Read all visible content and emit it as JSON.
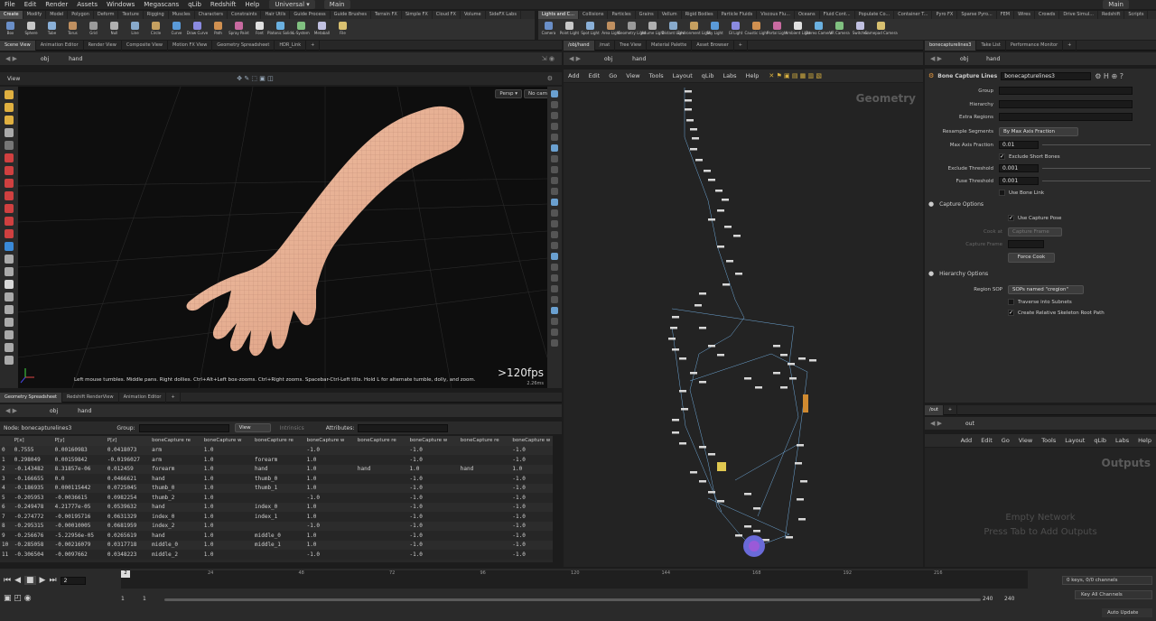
{
  "menubar": {
    "items": [
      "File",
      "Edit",
      "Render",
      "Assets",
      "Windows",
      "Megascans",
      "qLib",
      "Redshift",
      "Help"
    ],
    "desktop": "Universal",
    "scene": "Main",
    "right_title": "Main"
  },
  "shelf_tabs_left": [
    "Create",
    "Modify",
    "Model",
    "Polygon",
    "Deform",
    "Texture",
    "Rigging",
    "Muscles",
    "Characters",
    "Constraints",
    "Hair Utils",
    "Guide Process",
    "Guide Brushes",
    "Terrain FX",
    "Simple FX",
    "Cloud FX",
    "Volume",
    "SideFX Labs"
  ],
  "shelf_tabs_right": [
    "Lights and C...",
    "Collisions",
    "Particles",
    "Grains",
    "Vellum",
    "Rigid Bodies",
    "Particle Fluids",
    "Viscous Flu...",
    "Oceans",
    "Fluid Cont...",
    "Populate Co...",
    "Container T...",
    "Pyro FX",
    "Sparse Pyro...",
    "FEM",
    "Wires",
    "Crowds",
    "Drive Simul...",
    "Redshift",
    "Scripts"
  ],
  "shelf_tools_left": [
    "Box",
    "Sphere",
    "Tube",
    "Torus",
    "Grid",
    "Null",
    "Line",
    "Circle",
    "Curve",
    "Draw Curve",
    "Path",
    "Spray Paint",
    "Font",
    "Platonic Solids",
    "L-System",
    "Metaball",
    "File"
  ],
  "shelf_tools_right": [
    "Camera",
    "Point Light",
    "Spot Light",
    "Area Light",
    "Geometry Light",
    "Volume Light",
    "Distant Light",
    "Environment Light",
    "Sky Light",
    "GI Light",
    "Caustic Light",
    "Portal Light",
    "Ambient Light",
    "Stereo Camera",
    "VR Camera",
    "Switcher",
    "Gamepad Camera"
  ],
  "left_panetabs": [
    "Scene View",
    "Animation Editor",
    "Render View",
    "Composite View",
    "Motion FX View",
    "Geometry Spreadsheet",
    "HDR_Link"
  ],
  "mid_panetabs": [
    "/obj/hand",
    "/mat",
    "Tree View",
    "Material Palette",
    "Asset Browser"
  ],
  "right_panetabs": [
    "bonecapturelines3",
    "Take List",
    "Performance Monitor"
  ],
  "path": {
    "obj": "obj",
    "hand": "hand"
  },
  "viewport": {
    "title": "View",
    "camera_mode": "Persp",
    "camera": "No cam",
    "hint": "Left mouse tumbles. Middle pans. Right dollies. Ctrl+Alt+Left box-zooms. Ctrl+Right zooms. Spacebar-Ctrl-Left tilts. Hold L for alternate tumble, dolly, and zoom.",
    "fps": ">120fps",
    "ms": "2.26ms"
  },
  "bottom_left_tabs": [
    "Geometry Spreadsheet",
    "Redshift RenderView",
    "Animation Editor"
  ],
  "spreadsheet": {
    "node_label": "Node: bonecapturelines3",
    "group_label": "Group:",
    "view_label": "View",
    "intrinsics_label": "Intrinsics",
    "attributes_label": "Attributes:",
    "columns": [
      "",
      "P[x]",
      "P[y]",
      "P[z]",
      "boneCapture re",
      "boneCapture w",
      "boneCapture re",
      "boneCapture w",
      "boneCapture re",
      "boneCapture w",
      "boneCapture re",
      "boneCapture w",
      ""
    ],
    "rows": [
      [
        "0",
        "0.7555",
        "0.00160983",
        "0.0418073",
        "arm",
        "1.0",
        "",
        "-1.0",
        "",
        "-1.0",
        "",
        "-1.0",
        ""
      ],
      [
        "1",
        "0.298049",
        "0.00159842",
        "-0.0196027",
        "arm",
        "1.0",
        "forearm",
        "1.0",
        "",
        "-1.0",
        "",
        "-1.0",
        ""
      ],
      [
        "2",
        "-0.143482",
        "8.31857e-06",
        "0.012459",
        "forearm",
        "1.0",
        "hand",
        "1.0",
        "hand",
        "1.0",
        "hand",
        "1.0",
        "han"
      ],
      [
        "3",
        "-0.166655",
        "0.0",
        "0.0466621",
        "hand",
        "1.0",
        "thumb_0",
        "1.0",
        "",
        "-1.0",
        "",
        "-1.0",
        ""
      ],
      [
        "4",
        "-0.186935",
        "0.000115442",
        "0.0725045",
        "thumb_0",
        "1.0",
        "thumb_1",
        "1.0",
        "",
        "-1.0",
        "",
        "-1.0",
        ""
      ],
      [
        "5",
        "-0.205953",
        "-0.0036615",
        "0.0982254",
        "thumb_2",
        "1.0",
        "",
        "-1.0",
        "",
        "-1.0",
        "",
        "-1.0",
        ""
      ],
      [
        "6",
        "-0.249478",
        "4.21777e-05",
        "0.0539632",
        "hand",
        "1.0",
        "index_0",
        "1.0",
        "",
        "-1.0",
        "",
        "-1.0",
        ""
      ],
      [
        "7",
        "-0.274772",
        "-0.00195716",
        "0.0631329",
        "index_0",
        "1.0",
        "index_1",
        "1.0",
        "",
        "-1.0",
        "",
        "-1.0",
        ""
      ],
      [
        "8",
        "-0.295315",
        "-0.00010005",
        "0.0681959",
        "index_2",
        "1.0",
        "",
        "-1.0",
        "",
        "-1.0",
        "",
        "-1.0",
        ""
      ],
      [
        "9",
        "-0.256676",
        "-5.22956e-05",
        "0.0265619",
        "hand",
        "1.0",
        "middle_0",
        "1.0",
        "",
        "-1.0",
        "",
        "-1.0",
        ""
      ],
      [
        "10",
        "-0.285058",
        "-0.00216079",
        "0.0317718",
        "middle_0",
        "1.0",
        "middle_1",
        "1.0",
        "",
        "-1.0",
        "",
        "-1.0",
        ""
      ],
      [
        "11",
        "-0.306504",
        "-0.0097662",
        "0.0348223",
        "middle_2",
        "1.0",
        "",
        "-1.0",
        "",
        "-1.0",
        "",
        "-1.0",
        ""
      ]
    ]
  },
  "network": {
    "menu": [
      "Add",
      "Edit",
      "Go",
      "View",
      "Tools",
      "Layout",
      "qLib",
      "Labs",
      "Help"
    ],
    "watermark": "Geometry"
  },
  "params": {
    "node_type": "Bone Capture Lines",
    "node_name": "bonecapturelines3",
    "group_label": "Group",
    "hierarchy_label": "Hierarchy",
    "extra_regions_label": "Extra Regions",
    "resample_label": "Resample Segments",
    "resample_value": "By Max Axis Fraction",
    "max_axis_label": "Max Axis Fraction",
    "max_axis_value": "0.01",
    "exclude_short_label": "Exclude Short Bones",
    "exclude_threshold_label": "Exclude Threshold",
    "exclude_threshold_value": "0.001",
    "fuse_threshold_label": "Fuse Threshold",
    "fuse_threshold_value": "0.001",
    "use_bone_link_label": "Use Bone Link",
    "capture_options_label": "Capture Options",
    "use_capture_pose_label": "Use Capture Pose",
    "cook_at_label": "Cook at",
    "cook_at_value": "Capture Frame",
    "capture_frame_label": "Capture Frame",
    "force_cook_label": "Force Cook",
    "hierarchy_options_label": "Hierarchy Options",
    "region_sop_label": "Region SOP",
    "region_sop_value": "SOPs named \"cregion\"",
    "traverse_label": "Traverse into Subnets",
    "create_relative_label": "Create Relative Skeleton Root Path"
  },
  "out_panel": {
    "path_tab": "/out",
    "path": "out",
    "menu": [
      "Add",
      "Edit",
      "Go",
      "View",
      "Tools",
      "Layout",
      "qLib",
      "Labs",
      "Help"
    ],
    "watermark": "Outputs",
    "empty_line1": "Empty Network",
    "empty_line2": "Press Tab to Add Outputs"
  },
  "timeline": {
    "current_frame": "2",
    "ticks": [
      "24",
      "48",
      "72",
      "96",
      "120",
      "144",
      "168",
      "192",
      "216"
    ],
    "marker_frame": "2",
    "start": "1",
    "start2": "1",
    "end": "240",
    "end2": "240",
    "keys_info": "0 keys, 0/0 channels",
    "key_all": "Key All Channels",
    "auto_update": "Auto Update"
  },
  "colors": {
    "accent": "#f0a030",
    "selection": "#6a6ad8",
    "wire": "#6fa8d8"
  }
}
